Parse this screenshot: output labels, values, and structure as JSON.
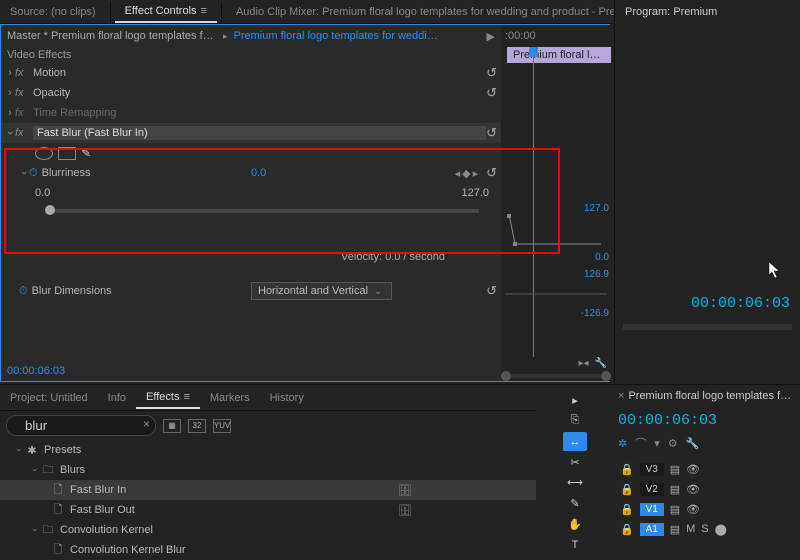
{
  "top": {
    "source_label": "Source: (no clips)",
    "effect_controls_tab": "Effect Controls",
    "audio_mixer_tab": "Audio Clip Mixer: Premium floral logo templates for wedding and product - Premi…"
  },
  "program_panel_label": "Program: Premium",
  "ec": {
    "master_label": "Master * Premium floral logo templates for …",
    "clip_label": "Premium floral logo templates for weddi…",
    "timeline_start": ":00:00",
    "video_effects_label": "Video Effects",
    "motion": "Motion",
    "opacity": "Opacity",
    "time_remapping": "Time Remapping",
    "fast_blur": "Fast Blur (Fast Blur In)",
    "blurriness_label": "Blurriness",
    "blurriness_value": "0.0",
    "slider_min": "0.0",
    "slider_max": "127.0",
    "velocity_label": "Velocity: 0.0 / second",
    "blur_dimensions_label": "Blur Dimensions",
    "blur_dimensions_value": "Horizontal and Vertical",
    "graph_top": "127.0",
    "graph_bottom": "0.0",
    "graph_vel_top": "126.9",
    "graph_vel_bottom": "-126.9",
    "prerendered_clip_label": "Premium floral logo template",
    "timecode": "00:00:06:03"
  },
  "right": {
    "timecode": "00:00:06:03"
  },
  "effects_panel": {
    "tabs": {
      "project": "Project: Untitled",
      "info": "Info",
      "effects": "Effects",
      "markers": "Markers",
      "history": "History"
    },
    "search_value": "blur",
    "presets": "Presets",
    "blurs_folder": "Blurs",
    "fast_blur_in": "Fast Blur In",
    "fast_blur_out": "Fast Blur Out",
    "conv_folder": "Convolution Kernel",
    "conv_blur": "Convolution Kernel Blur",
    "badge_32": "32",
    "badge_yuv": "YUV"
  },
  "timeline": {
    "title": "Premium floral logo templates for wedding",
    "timecode": "00:00:06:03",
    "tracks": {
      "v3": "V3",
      "v2": "V2",
      "v1": "V1",
      "a1": "A1",
      "m": "M",
      "s": "S"
    }
  }
}
